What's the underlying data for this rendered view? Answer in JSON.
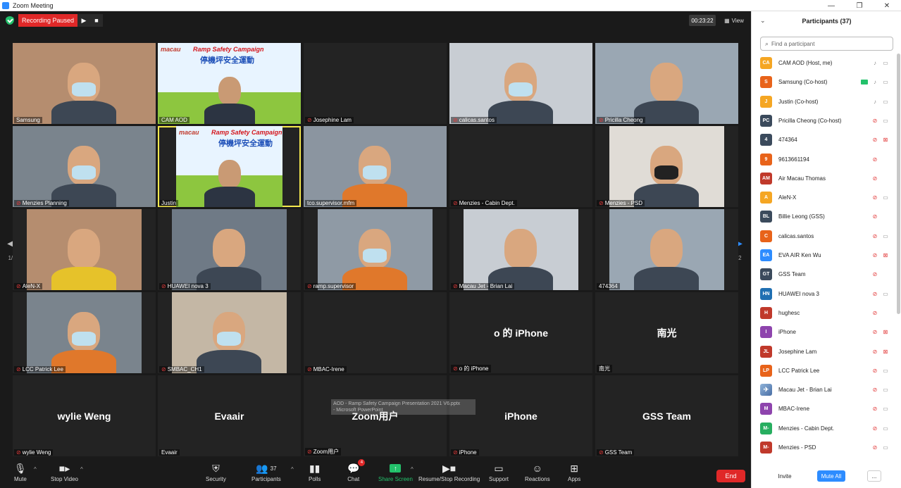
{
  "window": {
    "title": "Zoom Meeting",
    "minimize": "—",
    "restore": "❐",
    "close": "✕"
  },
  "topbar": {
    "recording_status": "Recording Paused",
    "resume_icon": "▶",
    "stop_icon": "■",
    "timer": "00:23:22",
    "view_label": "View"
  },
  "grid": {
    "page_indicator": "1/2",
    "tiles": [
      {
        "name": "Samsung",
        "muted": false,
        "content": "video"
      },
      {
        "name": "CAM AOD",
        "muted": false,
        "content": "slide"
      },
      {
        "name": "Josephine Lam",
        "muted": true,
        "content": "empty"
      },
      {
        "name": "calicas.santos",
        "muted": true,
        "content": "video"
      },
      {
        "name": "Pricilla Cheong",
        "muted": true,
        "content": "video"
      },
      {
        "name": "Menzies Planning",
        "muted": true,
        "content": "video"
      },
      {
        "name": "Justin",
        "muted": false,
        "content": "slide",
        "active": true
      },
      {
        "name": "tco.supervisor.mfm",
        "muted": false,
        "content": "video"
      },
      {
        "name": "Menzies - Cabin Dept.",
        "muted": true,
        "content": "empty"
      },
      {
        "name": "Menzies - PSD",
        "muted": true,
        "content": "video"
      },
      {
        "name": "AleN-X",
        "muted": true,
        "content": "video"
      },
      {
        "name": "HUAWEI nova 3",
        "muted": true,
        "content": "video"
      },
      {
        "name": "ramp.supervisor",
        "muted": true,
        "content": "video"
      },
      {
        "name": "Macau Jet - Brian Lai",
        "muted": true,
        "content": "video"
      },
      {
        "name": "474364",
        "muted": false,
        "content": "video"
      },
      {
        "name": "LCC Patrick Lee",
        "muted": true,
        "content": "video"
      },
      {
        "name": "SMBAC_CH1",
        "muted": true,
        "content": "video"
      },
      {
        "name": "MBAC-Irene",
        "muted": true,
        "content": "empty"
      },
      {
        "name": "o 的 iPhone",
        "muted": true,
        "content": "name",
        "display": "o 的 iPhone"
      },
      {
        "name": "南光",
        "muted": false,
        "content": "name",
        "display": "南光"
      },
      {
        "name": "wylie Weng",
        "muted": true,
        "content": "name",
        "display": "wylie Weng"
      },
      {
        "name": "Evaair",
        "muted": false,
        "content": "name",
        "display": "Evaair"
      },
      {
        "name": "Zoom用户",
        "muted": true,
        "content": "name",
        "display": "Zoom用户"
      },
      {
        "name": "iPhone",
        "muted": true,
        "content": "name",
        "display": "iPhone"
      },
      {
        "name": "GSS Team",
        "muted": true,
        "content": "name",
        "display": "GSS Team"
      }
    ],
    "slide_title": "Ramp Safety Campaign",
    "slide_year": "2021",
    "slide_cn": "停機坪安全運動",
    "slide_brand": "macau",
    "tooltip_line1": "AOD - Ramp Safety Campaign Presentation 2021 V6.pptx",
    "tooltip_line2": "- Microsoft PowerPoint"
  },
  "toolbar": {
    "mute": "Mute",
    "stop_video": "Stop Video",
    "security": "Security",
    "participants": "Participants",
    "participants_count": "37",
    "polls": "Polls",
    "chat": "Chat",
    "chat_badge": "4",
    "share_screen": "Share Screen",
    "resume_stop_recording": "Resume/Stop Recording",
    "support": "Support",
    "reactions": "Reactions",
    "apps": "Apps",
    "end": "End"
  },
  "panel": {
    "title": "Participants (37)",
    "search_placeholder": "Find a participant",
    "participants": [
      {
        "initials": "CA",
        "name": "CAM AOD (Host, me)",
        "color": "#f5a623",
        "mic": "on",
        "video": "on"
      },
      {
        "initials": "S",
        "name": "Samsung (Co-host)",
        "color": "#e8631a",
        "mic": "on",
        "video": "on",
        "sharing": true
      },
      {
        "initials": "J",
        "name": "Justin (Co-host)",
        "color": "#f5a623",
        "mic": "on",
        "video": "on"
      },
      {
        "initials": "PC",
        "name": "Pricilla Cheong (Co-host)",
        "color": "#3b4a5c",
        "mic": "off",
        "video": "on"
      },
      {
        "initials": "4",
        "name": "474364",
        "color": "#3b4a5c",
        "mic": "off",
        "video": "off"
      },
      {
        "initials": "9",
        "name": "9613661194",
        "color": "#e8631a",
        "mic": "off",
        "video": "none"
      },
      {
        "initials": "AM",
        "name": "Air Macau Thomas",
        "color": "#c0392b",
        "mic": "off",
        "video": "none"
      },
      {
        "initials": "A",
        "name": "AleN-X",
        "color": "#f5a623",
        "mic": "off",
        "video": "on"
      },
      {
        "initials": "BL",
        "name": "Billie Leong (GSS)",
        "color": "#3b4a5c",
        "mic": "off",
        "video": "none"
      },
      {
        "initials": "C",
        "name": "calicas.santos",
        "color": "#e8631a",
        "mic": "off",
        "video": "on"
      },
      {
        "initials": "EA",
        "name": "EVA AIR Ken Wu",
        "color": "#2d8cff",
        "mic": "off",
        "video": "off"
      },
      {
        "initials": "GT",
        "name": "GSS Team",
        "color": "#3b4a5c",
        "mic": "off",
        "video": "none"
      },
      {
        "initials": "HN",
        "name": "HUAWEI nova 3",
        "color": "#1f6fb2",
        "mic": "off",
        "video": "on"
      },
      {
        "initials": "H",
        "name": "hughesc",
        "color": "#c0392b",
        "mic": "off",
        "video": "none"
      },
      {
        "initials": "I",
        "name": "iPhone",
        "color": "#8e44ad",
        "mic": "off",
        "video": "off"
      },
      {
        "initials": "JL",
        "name": "Josephine Lam",
        "color": "#c0392b",
        "mic": "off",
        "video": "off"
      },
      {
        "initials": "LP",
        "name": "LCC Patrick Lee",
        "color": "#e8631a",
        "mic": "off",
        "video": "on"
      },
      {
        "initials": "",
        "name": "Macau Jet - Brian Lai",
        "color": "#4a6fa5",
        "mic": "off",
        "video": "on",
        "photo": true
      },
      {
        "initials": "M",
        "name": "MBAC-Irene",
        "color": "#8e44ad",
        "mic": "off",
        "video": "on"
      },
      {
        "initials": "M-",
        "name": "Menzies - Cabin Dept.",
        "color": "#27ae60",
        "mic": "off",
        "video": "on"
      },
      {
        "initials": "M-",
        "name": "Menzies - PSD",
        "color": "#c0392b",
        "mic": "off",
        "video": "on"
      }
    ],
    "invite": "Invite",
    "mute_all": "Mute All",
    "more": "..."
  }
}
